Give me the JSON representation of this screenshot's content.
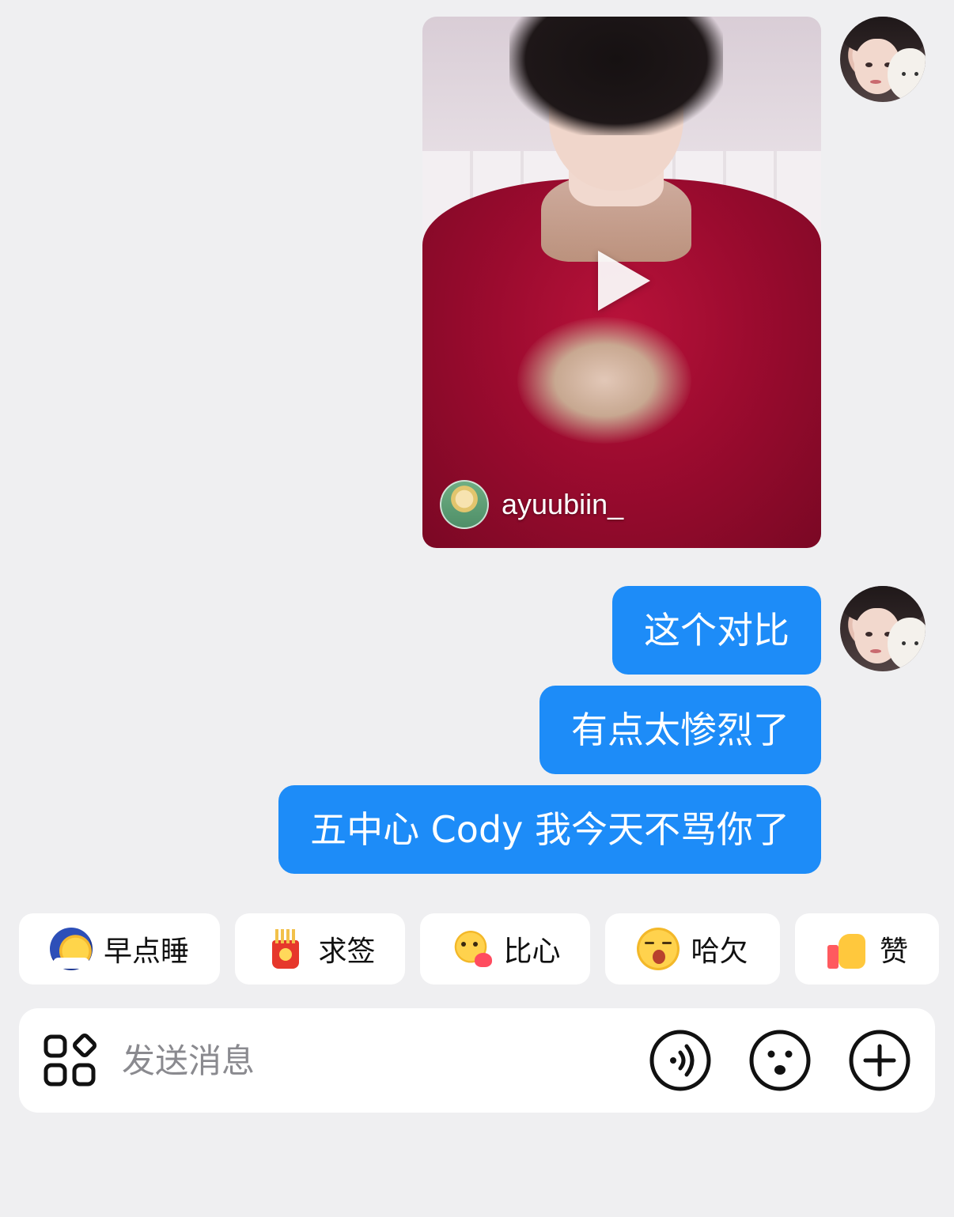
{
  "video_card": {
    "author": "ayuubiin_"
  },
  "messages": [
    "这个对比",
    "有点太惨烈了",
    "五中心 Cody 我今天不骂你了"
  ],
  "quick_replies": [
    {
      "label": "早点睡",
      "icon": "sleep-moon-icon"
    },
    {
      "label": "求签",
      "icon": "fortune-sticks-icon"
    },
    {
      "label": "比心",
      "icon": "heart-hands-icon"
    },
    {
      "label": "哈欠",
      "icon": "yawn-face-icon"
    },
    {
      "label": "赞",
      "icon": "thumbs-up-icon"
    }
  ],
  "composer": {
    "placeholder": "发送消息",
    "icons": [
      "apps-icon",
      "voice-icon",
      "emoji-icon",
      "plus-icon"
    ]
  },
  "colors": {
    "background": "#efeff1",
    "bubble": "#1d8cf8",
    "bubble_text": "#ffffff",
    "panel": "#ffffff"
  }
}
